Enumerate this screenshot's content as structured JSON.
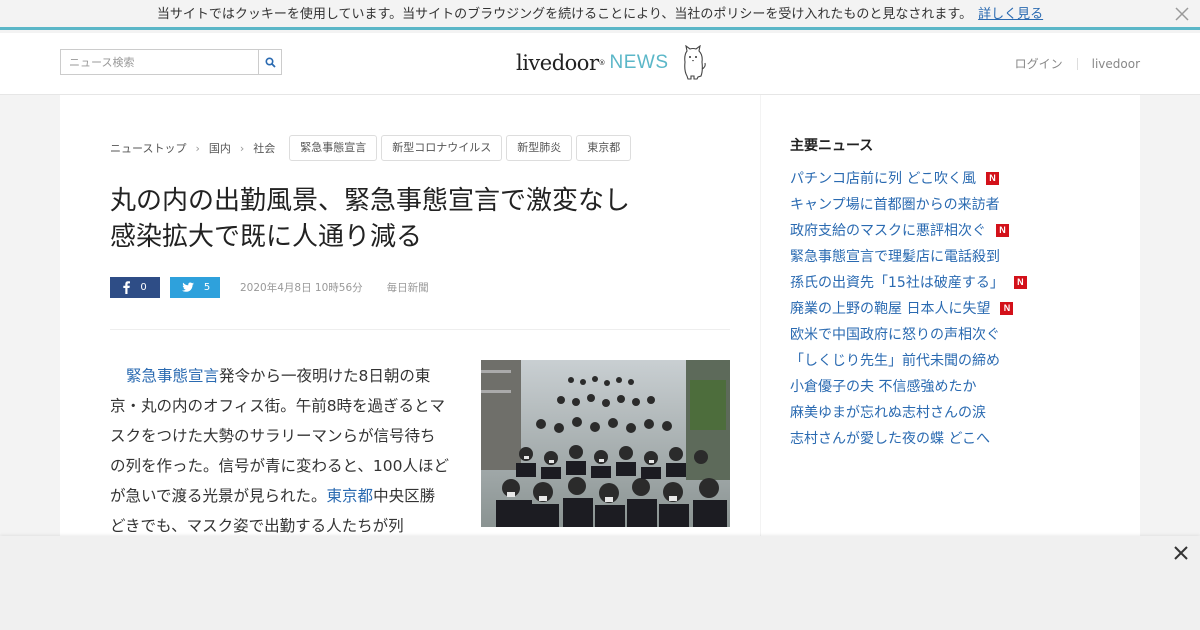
{
  "cookie": {
    "message": "当サイトではクッキーを使用しています。当サイトのブラウジングを続けることにより、当社のポリシーを受け入れたものと見なされます。",
    "link": "詳しく見る"
  },
  "header": {
    "search_placeholder": "ニュース検索",
    "logo_livedoor": "livedoor",
    "logo_reg": "®",
    "logo_news": "NEWS",
    "nav": [
      "ログイン",
      "livedoor"
    ]
  },
  "breadcrumb": [
    "ニューストップ",
    "国内",
    "社会"
  ],
  "tags": [
    "緊急事態宣言",
    "新型コロナウイルス",
    "新型肺炎",
    "東京都"
  ],
  "article": {
    "title_line1": "丸の内の出勤風景、緊急事態宣言で激変なし",
    "title_line2": "感染拡大で既に人通り減る",
    "fb_count": "0",
    "tw_count": "5",
    "date": "2020年4月8日 10時56分",
    "source": "毎日新聞",
    "body_link1": "緊急事態宣言",
    "body_part1": "発令から一夜明けた8日朝の東京・丸の内のオフィス街。午前8時を過ぎるとマスクをつけた大勢のサラリーマンらが信号待ちの列を作った。信号が青に変わると、100人ほどが急いで渡る光景が見られた。",
    "body_link2": "東京都",
    "body_part2": "中央区勝どきでも、マスク姿で出勤する人たちが列"
  },
  "sidebar": {
    "title": "主要ニュース",
    "items": [
      {
        "label": "パチンコ店前に列 どこ吹く風",
        "new": true
      },
      {
        "label": "キャンプ場に首都圏からの来訪者",
        "new": false
      },
      {
        "label": "政府支給のマスクに悪評相次ぐ",
        "new": true
      },
      {
        "label": "緊急事態宣言で理髪店に電話殺到",
        "new": false
      },
      {
        "label": "孫氏の出資先「15社は破産する」",
        "new": true
      },
      {
        "label": "廃業の上野の鞄屋 日本人に失望",
        "new": true
      },
      {
        "label": "欧米で中国政府に怒りの声相次ぐ",
        "new": false
      },
      {
        "label": "「しくじり先生」前代未聞の締め",
        "new": false
      },
      {
        "label": "小倉優子の夫 不信感強めたか",
        "new": false
      },
      {
        "label": "麻美ゆまが忘れぬ志村さんの涙",
        "new": false
      },
      {
        "label": "志村さんが愛した夜の蝶 どこへ",
        "new": false
      }
    ],
    "new_badge": "N"
  },
  "colors": {
    "accent": "#5bb7c8",
    "link": "#2a6ab1",
    "facebook": "#2e4d86",
    "twitter": "#2ea1dc",
    "new_badge": "#d3111a"
  }
}
